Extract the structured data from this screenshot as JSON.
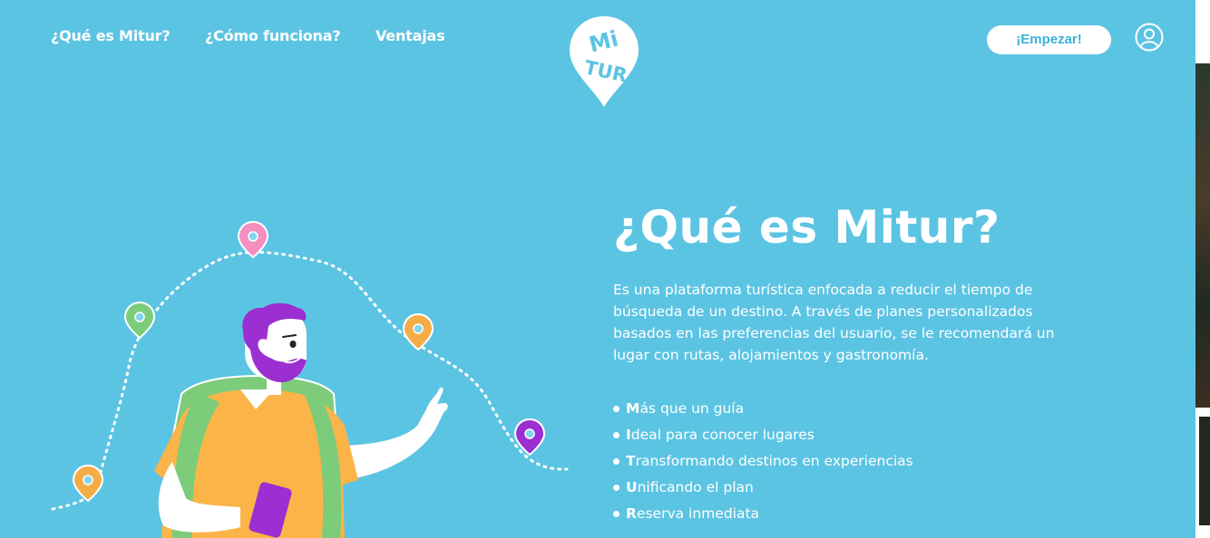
{
  "nav": {
    "links": [
      "¿Qué es Mitur?",
      "¿Cómo funciona?",
      "Ventajas"
    ],
    "cta_label": "¡Empezar!"
  },
  "logo": {
    "text_top": "Mi",
    "text_bottom": "TUR"
  },
  "main": {
    "title": "¿Qué es Mitur?",
    "description": "Es una plataforma turística enfocada a reducir el tiempo de búsqueda de un destino. A través de planes personalizados basados en las preferencias del usuario, se le recomendará un lugar con rutas, alojamientos y gastronomía.",
    "features": [
      {
        "initial": "M",
        "rest": "ás que un guía"
      },
      {
        "initial": "I",
        "rest": "deal para conocer lugares"
      },
      {
        "initial": "T",
        "rest": "ransformando destinos en experiencias"
      },
      {
        "initial": "U",
        "rest": "nificando el plan"
      },
      {
        "initial": "R",
        "rest": "eserva inmediata"
      }
    ]
  },
  "colors": {
    "background": "#5cc4e3",
    "accent_text": "#3bb2d8",
    "pin_pink": "#f48fc0",
    "pin_green": "#7ccc7a",
    "pin_orange": "#f6ac46",
    "pin_purple": "#9b2fd1",
    "hair_purple": "#9b2fd1",
    "shirt_orange": "#fbb448",
    "backpack_green": "#7ccc7a"
  }
}
